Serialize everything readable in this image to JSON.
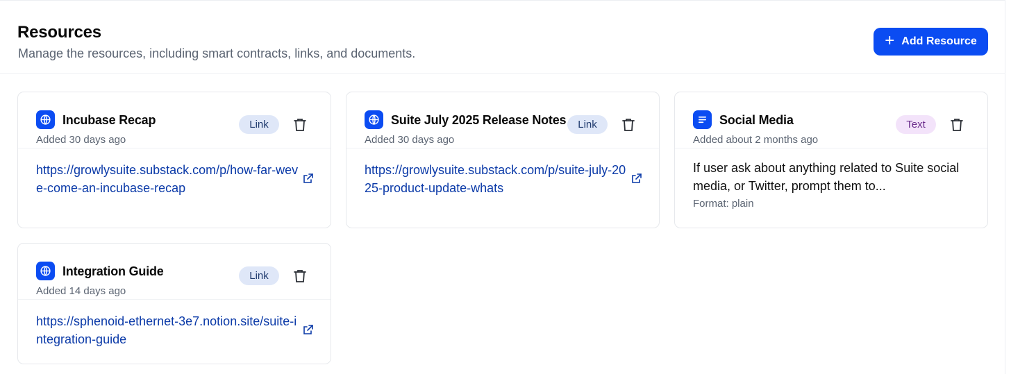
{
  "header": {
    "title": "Resources",
    "subtitle": "Manage the resources, including smart contracts, links, and documents.",
    "add_button_label": "Add Resource"
  },
  "colors": {
    "accent": "#0b4cf2",
    "link_text": "#0b3aa8",
    "link_badge_bg": "#dfe7f8",
    "text_badge_bg": "#f3e3fa"
  },
  "cards": [
    {
      "title": "Incubase Recap",
      "added": "Added 30 days ago",
      "badge": "Link",
      "type_icon": "globe-icon",
      "url": "https://growlysuite.substack.com/p/how-far-weve-come-an-incubase-recap"
    },
    {
      "title": "Suite July 2025 Release Notes",
      "added": "Added 30 days ago",
      "badge": "Link",
      "type_icon": "globe-icon",
      "url": "https://growlysuite.substack.com/p/suite-july-2025-product-update-whats"
    },
    {
      "title": "Social Media",
      "added": "Added about 2 months ago",
      "badge": "Text",
      "type_icon": "document-icon",
      "content": "If user ask about anything related to Suite social media, or Twitter, prompt them to...",
      "format": "Format: plain"
    },
    {
      "title": "Integration Guide",
      "added": "Added 14 days ago",
      "badge": "Link",
      "type_icon": "globe-icon",
      "url": "https://sphenoid-ethernet-3e7.notion.site/suite-integration-guide"
    }
  ]
}
